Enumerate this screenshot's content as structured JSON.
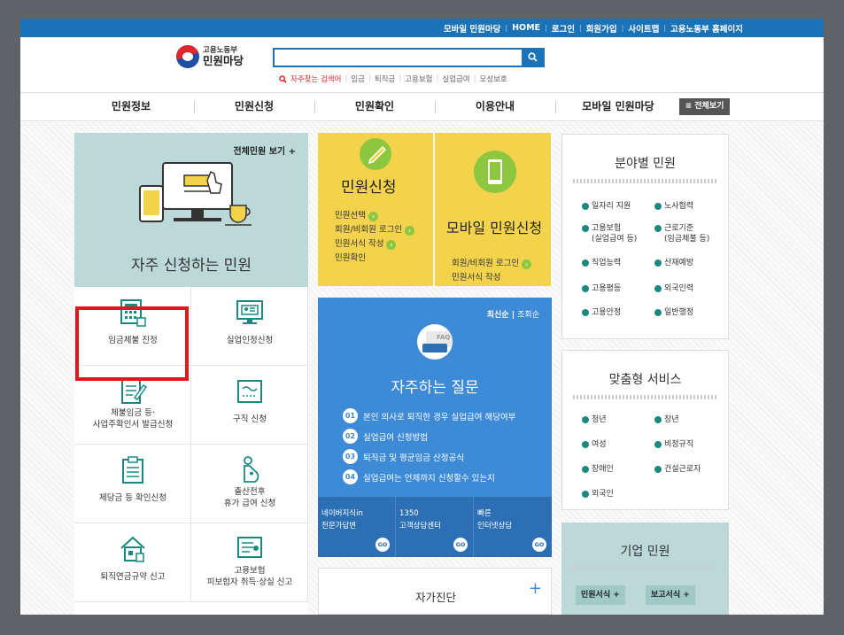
{
  "topbar": {
    "links": [
      "모바일 민원마당",
      "HOME",
      "로그인",
      "회원가입",
      "사이트맵",
      "고용노동부 홈페이지"
    ],
    "sep": "|"
  },
  "header": {
    "logo_line1": "고용노동부",
    "logo_line2": "민원마당",
    "popular_label": "자주찾는 검색어",
    "popular": [
      "임금",
      "퇴직금",
      "고용보험",
      "실업급여",
      "모성보호"
    ],
    "search_icon": "search-icon",
    "sep": "|"
  },
  "nav": {
    "items": [
      "민원정보",
      "민원신청",
      "민원확인",
      "이용안내",
      "모바일 민원마당"
    ],
    "all_label": "≡ 전체보기"
  },
  "freq": {
    "all_link": "전체민원 보기 +",
    "title": "자주 신청하는 민원"
  },
  "grid": {
    "cells": [
      "임금체불 진정",
      "실업인정신청",
      "체불임금 등·\n사업주확인서 발급신청",
      "구직 신청",
      "체당금 등 확인신청",
      "출산전후\n휴가 급여 신청",
      "퇴직연금규약 신고",
      "고용보험\n피보험자 취득·상실 신고"
    ]
  },
  "civil": {
    "title": "민원신청",
    "items": [
      "민원선택",
      "회원/비회원 로그인",
      "민원서식 작성",
      "민원확인"
    ],
    "arrow": "›"
  },
  "mobile": {
    "title": "모바일 민원신청",
    "items": [
      "회원/비회원 로그인",
      "민원서식 작성"
    ],
    "arrow": "›"
  },
  "faq": {
    "sort_new": "최신순",
    "sort_sep": "|",
    "sort_views": "조회순",
    "icon_text": "FAQ",
    "title": "자주하는 질문",
    "items": [
      {
        "num": "01",
        "text": "본인 의사로 퇴직한 경우 실업급여 해당여부"
      },
      {
        "num": "02",
        "text": "실업급여 신청방법"
      },
      {
        "num": "03",
        "text": "퇴직금 및 평균임금 산정공식"
      },
      {
        "num": "04",
        "text": "실업급여는 언제까지 신청할수 있는지"
      }
    ],
    "bottom": [
      {
        "l1": "네이버지식in",
        "l2": "전문가답변",
        "go": "GO"
      },
      {
        "l1": "1350",
        "l2": "고객상담센터",
        "go": "GO"
      },
      {
        "l1": "빠른",
        "l2": "인터넷상담",
        "go": "GO"
      }
    ]
  },
  "selfdiag": {
    "title": "자가진단",
    "plus": "+"
  },
  "field": {
    "title": "분야별 민원",
    "items": [
      "일자리 지원",
      "노사협력",
      "고용보험\n(실업급여 등)",
      "근로기준\n(임금체불 등)",
      "직업능력",
      "산재예방",
      "고용평등",
      "외국인력",
      "고용안정",
      "일반행정"
    ]
  },
  "custom": {
    "title": "맞춤형 서비스",
    "items": [
      "청년",
      "장년",
      "여성",
      "비정규직",
      "장애인",
      "건설근로자",
      "외국인"
    ]
  },
  "biz": {
    "title": "기업 민원",
    "tags": [
      "민원서식  +",
      "보고서식  +"
    ]
  },
  "colors": {
    "blue": "#1a73b8",
    "yellow": "#f3d24c",
    "teal": "#bcd9d8",
    "faq": "#3d8ad6",
    "red": "#e3161e"
  }
}
